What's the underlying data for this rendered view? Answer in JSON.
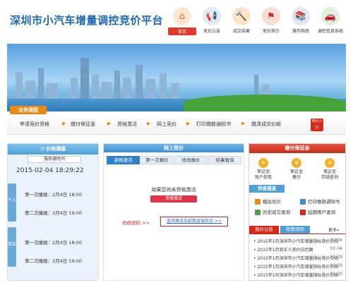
{
  "header": {
    "title": "深圳市小汽车增量调控竞价平台",
    "nav": [
      {
        "label": "首页",
        "icon": "home-icon",
        "glyph": "⌂",
        "active": true
      },
      {
        "label": "竞价公告",
        "icon": "megaphone-icon",
        "glyph": "📢",
        "active": false
      },
      {
        "label": "成交结果",
        "icon": "gavel-icon",
        "glyph": "🔨",
        "active": false
      },
      {
        "label": "竞价指引",
        "icon": "signpost-icon",
        "glyph": "⚑",
        "active": false
      },
      {
        "label": "操作指南",
        "icon": "books-icon",
        "glyph": "📚",
        "active": false
      },
      {
        "label": "调控信息系统",
        "icon": "car-icon",
        "glyph": "🚗",
        "active": false
      }
    ]
  },
  "flow": {
    "tag": "业务流程",
    "steps": [
      "申请竞价资格",
      "缴付保证金",
      "资格激活",
      "网上竞价",
      "打印缴款通知书",
      "缴清成交价款"
    ],
    "hot_badge": "竞价入口"
  },
  "left_panel": {
    "title": "价格播报",
    "server_label": "服务器时间",
    "server_time": "2015-02-04 18:29:22",
    "side_tabs": [
      "个人",
      "单位"
    ],
    "personal": [
      "第一次播报：2月4日 18:00",
      "第二次播报：2月4日 19:00"
    ],
    "company": [
      "第一次播报：2月4日 18:00",
      "第二次播报：2月4日 19:00"
    ]
  },
  "main_panel": {
    "title": "网上竞价",
    "tabs": [
      "资格激活",
      "第一次报价",
      "修改报价",
      "结果查询"
    ],
    "notice": "如果您尚未资格激活",
    "activate_button": "资格激活",
    "change_password": "修改密码 >>",
    "query_link": "查询激活及延期退保状态 >>"
  },
  "right_panel": {
    "title": "缴付保证金",
    "flow": [
      {
        "text": "保证金\n账户获取",
        "glyph": "¥"
      },
      {
        "text": "保证金\n缴付",
        "glyph": "¥"
      },
      {
        "text": "保证金\n存疑查询",
        "glyph": "¥"
      }
    ],
    "quick_title": "快速通道",
    "quick": [
      {
        "label": "模拟竞价",
        "color": "#e98a12"
      },
      {
        "label": "打印缴款通知书",
        "color": "#3d8dd0"
      },
      {
        "label": "历史成交查询",
        "color": "#4aa14a"
      },
      {
        "label": "延期用户查询",
        "color": "#d42a1a"
      }
    ],
    "news_tabs": [
      "竞价公告",
      "政策须知"
    ],
    "more": "更多»",
    "news": [
      {
        "title": "2015年1月深圳市小汽车增量指标竞价公告",
        "date": "02-04"
      },
      {
        "title": "2015年1月竞买人竞价日历图",
        "date": "02-04"
      },
      {
        "title": "2015年1月深圳市小汽车增量指标竞价公告",
        "date": "01-29"
      },
      {
        "title": "2015年1月深圳市小汽车增量指标竞价公告",
        "date": "01-29"
      },
      {
        "title": "2015年1月深圳市小汽车增量指标竞价公告",
        "date": "01-20"
      }
    ]
  }
}
